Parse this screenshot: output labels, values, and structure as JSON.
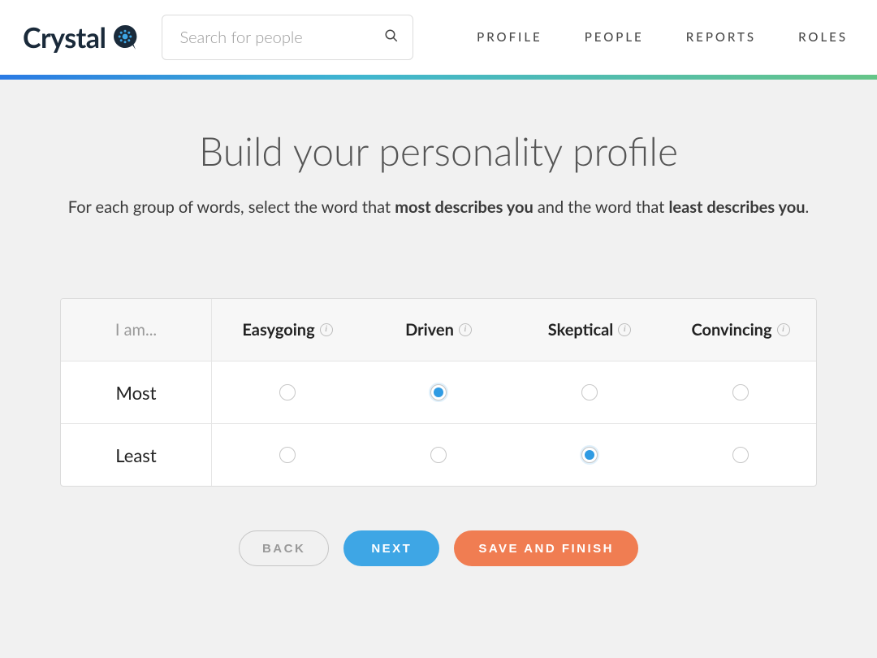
{
  "header": {
    "brand": "Crystal",
    "search_placeholder": "Search for people",
    "nav": [
      "PROFILE",
      "PEOPLE",
      "REPORTS",
      "ROLES"
    ]
  },
  "page": {
    "title": "Build your personality profile",
    "subtitle_pre": "For each group of words, select the word that ",
    "subtitle_b1": "most describes you",
    "subtitle_mid": " and the word that ",
    "subtitle_b2": "least describes you",
    "subtitle_post": "."
  },
  "table": {
    "row_label_head": "I am...",
    "traits": [
      "Easygoing",
      "Driven",
      "Skeptical",
      "Convincing"
    ],
    "rows": [
      {
        "label": "Most",
        "selected_index": 1
      },
      {
        "label": "Least",
        "selected_index": 2
      }
    ]
  },
  "buttons": {
    "back": "BACK",
    "next": "NEXT",
    "save": "SAVE AND FINISH"
  },
  "colors": {
    "accent_blue": "#3ea6e5",
    "accent_orange": "#f07d52"
  }
}
